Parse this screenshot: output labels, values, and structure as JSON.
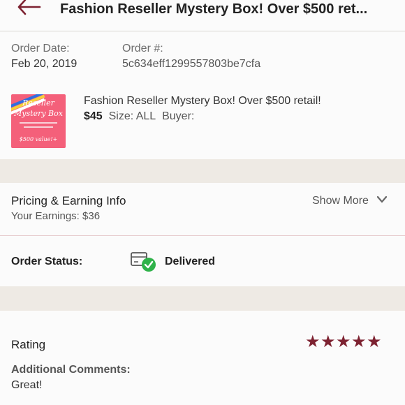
{
  "header": {
    "title": "Fashion Reseller Mystery Box! Over $500 ret..."
  },
  "order": {
    "date_label": "Order Date:",
    "date_value": "Feb 20, 2019",
    "number_label": "Order #:",
    "number_value": "5c634eff1299557803be7cfa"
  },
  "item": {
    "title": "Fashion Reseller Mystery Box! Over $500 retail!",
    "price": "$45",
    "size_label": "Size: ALL",
    "buyer_label": "Buyer:",
    "thumbnail": {
      "line1": "Reseller",
      "line2": "Mystery Box",
      "line3": "$500 value!+"
    }
  },
  "pricing": {
    "title": "Pricing & Earning Info",
    "earnings": "Your Earnings: $36",
    "show_more": "Show More"
  },
  "status": {
    "label": "Order Status:",
    "value": "Delivered"
  },
  "rating": {
    "title": "Rating",
    "stars": 5,
    "comments_label": "Additional Comments:",
    "comments_value": "Great!"
  },
  "colors": {
    "accent": "#7d2231",
    "success": "#2fb24a",
    "thumbnail_bg": "#f4607a"
  },
  "icons": [
    "back-arrow-icon",
    "chevron-down-icon",
    "package-delivered-icon",
    "star-icon"
  ]
}
